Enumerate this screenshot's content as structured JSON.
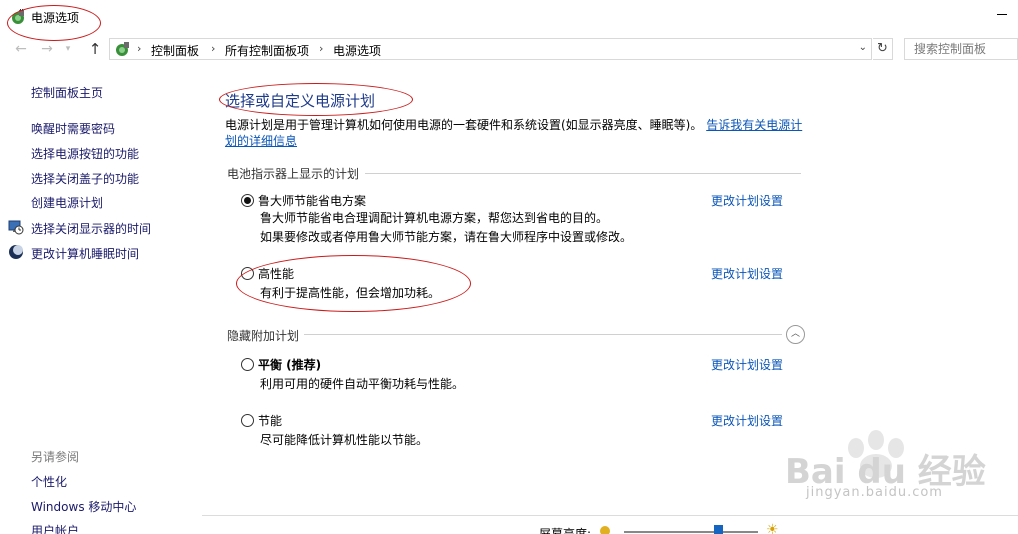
{
  "window": {
    "title": "电源选项",
    "minimize_label": ""
  },
  "nav": {
    "breadcrumbs": [
      "控制面板",
      "所有控制面板项",
      "电源选项"
    ],
    "search_placeholder": "搜索控制面板"
  },
  "sidebar": {
    "home": "控制面板主页",
    "items": [
      {
        "label": "唤醒时需要密码",
        "icon": ""
      },
      {
        "label": "选择电源按钮的功能",
        "icon": ""
      },
      {
        "label": "选择关闭盖子的功能",
        "icon": ""
      },
      {
        "label": "创建电源计划",
        "icon": ""
      },
      {
        "label": "选择关闭显示器的时间",
        "icon": "monitor-clock-icon"
      },
      {
        "label": "更改计算机睡眠时间",
        "icon": "moon-icon"
      }
    ],
    "see_also_heading": "另请参阅",
    "see_also": [
      "个性化",
      "Windows 移动中心",
      "用户帐户"
    ]
  },
  "main": {
    "title": "选择或自定义电源计划",
    "description": "电源计划是用于管理计算机如何使用电源的一套硬件和系统设置(如显示器亮度、睡眠等)。",
    "description_link": "告诉我有关电源计划的详细信息",
    "battery_section": "电池指示器上显示的计划",
    "hidden_section": "隐藏附加计划",
    "plans": [
      {
        "name": "鲁大师节能省电方案",
        "selected": true,
        "desc_lines": [
          "鲁大师节能省电合理调配计算机电源方案，帮您达到省电的目的。",
          "如果要修改或者停用鲁大师节能方案，请在鲁大师程序中设置或修改。"
        ],
        "link": "更改计划设置"
      },
      {
        "name": "高性能",
        "selected": false,
        "desc_lines": [
          "有利于提高性能，但会增加功耗。"
        ],
        "link": "更改计划设置"
      },
      {
        "name": "平衡 (推荐)",
        "selected": false,
        "desc_lines": [
          "利用可用的硬件自动平衡功耗与性能。"
        ],
        "link": "更改计划设置"
      },
      {
        "name": "节能",
        "selected": false,
        "desc_lines": [
          "尽可能降低计算机性能以节能。"
        ],
        "link": "更改计划设置"
      }
    ]
  },
  "bottom": {
    "brightness_label": "屏幕亮度:",
    "brightness_level": 0.7
  },
  "watermark": {
    "brand": "Bai du 经验",
    "url": "jingyan.baidu.com"
  },
  "colors": {
    "link": "#0b56b8",
    "title": "#1e3a8a",
    "annotation": "#cc1a1a",
    "slider_thumb": "#1565c0"
  }
}
